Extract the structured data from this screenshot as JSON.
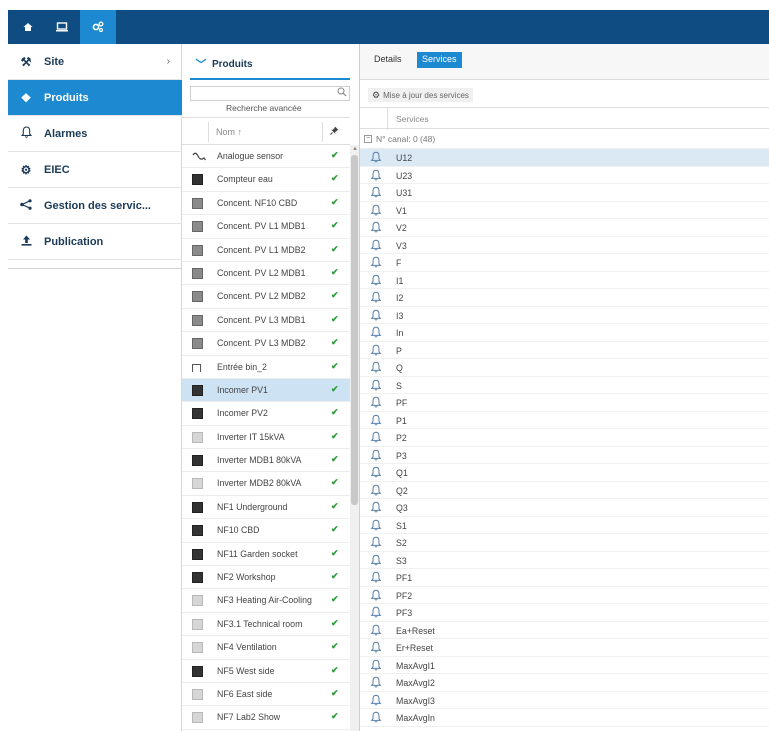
{
  "nav": {
    "items": [
      {
        "label": "Site",
        "icon": "wrench-icon",
        "glyph": "⚒",
        "chevron": "›",
        "active": false
      },
      {
        "label": "Produits",
        "icon": "product-icon",
        "glyph": "❖",
        "active": true
      },
      {
        "label": "Alarmes",
        "icon": "bell-icon",
        "glyph": "♫",
        "active": false
      },
      {
        "label": "EIEC",
        "icon": "gears-icon",
        "glyph": "⚙",
        "active": false
      },
      {
        "label": "Gestion des servic...",
        "icon": "share-icon",
        "glyph": "≺",
        "active": false
      },
      {
        "label": "Publication",
        "icon": "upload-icon",
        "glyph": "⇧",
        "active": false
      }
    ]
  },
  "products_panel": {
    "title": "Produits",
    "advanced_search": "Recherche avancée",
    "column_name": "Nom ↑",
    "items": [
      {
        "name": "Analogue sensor",
        "icon": "wave",
        "check": "✔"
      },
      {
        "name": "Compteur eau",
        "icon": "dark",
        "check": "✔"
      },
      {
        "name": "Concent. NF10 CBD",
        "icon": "mid",
        "check": "✔"
      },
      {
        "name": "Concent. PV L1 MDB1",
        "icon": "mid",
        "check": "✔"
      },
      {
        "name": "Concent. PV L1 MDB2",
        "icon": "mid",
        "check": "✔"
      },
      {
        "name": "Concent. PV L2 MDB1",
        "icon": "mid",
        "check": "✔"
      },
      {
        "name": "Concent. PV L2 MDB2",
        "icon": "mid",
        "check": "✔"
      },
      {
        "name": "Concent. PV L3 MDB1",
        "icon": "mid",
        "check": "✔"
      },
      {
        "name": "Concent. PV L3 MDB2",
        "icon": "mid",
        "check": "✔"
      },
      {
        "name": "Entrée bin_2",
        "icon": "pulse",
        "check": "✔"
      },
      {
        "name": "Incomer PV1",
        "icon": "dark",
        "check": "✔",
        "selected": true
      },
      {
        "name": "Incomer PV2",
        "icon": "dark",
        "check": "✔"
      },
      {
        "name": "Inverter IT 15kVA",
        "icon": "grey",
        "check": "✔"
      },
      {
        "name": "Inverter MDB1 80kVA",
        "icon": "dark",
        "check": "✔"
      },
      {
        "name": "Inverter MDB2 80kVA",
        "icon": "grey",
        "check": "✔"
      },
      {
        "name": "NF1 Underground",
        "icon": "dark",
        "check": "✔"
      },
      {
        "name": "NF10 CBD",
        "icon": "dark",
        "check": "✔"
      },
      {
        "name": "NF11 Garden socket",
        "icon": "dark",
        "check": "✔"
      },
      {
        "name": "NF2 Workshop",
        "icon": "dark",
        "check": "✔"
      },
      {
        "name": "NF3 Heating Air-Cooling",
        "icon": "grey",
        "check": "✔"
      },
      {
        "name": "NF3.1 Technical room",
        "icon": "grey",
        "check": "✔"
      },
      {
        "name": "NF4 Ventilation",
        "icon": "grey",
        "check": "✔"
      },
      {
        "name": "NF5 West side",
        "icon": "dark",
        "check": "✔"
      },
      {
        "name": "NF6 East side",
        "icon": "grey",
        "check": "✔"
      },
      {
        "name": "NF7 Lab2 Show",
        "icon": "grey",
        "check": "✔"
      }
    ]
  },
  "services_panel": {
    "tabs": {
      "details": "Details",
      "services": "Services"
    },
    "update_button": "Mise à jour des services",
    "column_services": "Services",
    "group_label": "N° canal: 0 (48)",
    "group_toggle": "−",
    "items": [
      "U12",
      "U23",
      "U31",
      "V1",
      "V2",
      "V3",
      "F",
      "I1",
      "I2",
      "I3",
      "In",
      "P",
      "Q",
      "S",
      "PF",
      "P1",
      "P2",
      "P3",
      "Q1",
      "Q2",
      "Q3",
      "S1",
      "S2",
      "S3",
      "PF1",
      "PF2",
      "PF3",
      "Ea+Reset",
      "Er+Reset",
      "MaxAvgI1",
      "MaxAvgI2",
      "MaxAvgI3",
      "MaxAvgIn"
    ]
  },
  "colors": {
    "brand": "#0f4c81",
    "accent": "#1d89d1",
    "check": "#2a9d3a",
    "selected": "#cde2f2"
  }
}
